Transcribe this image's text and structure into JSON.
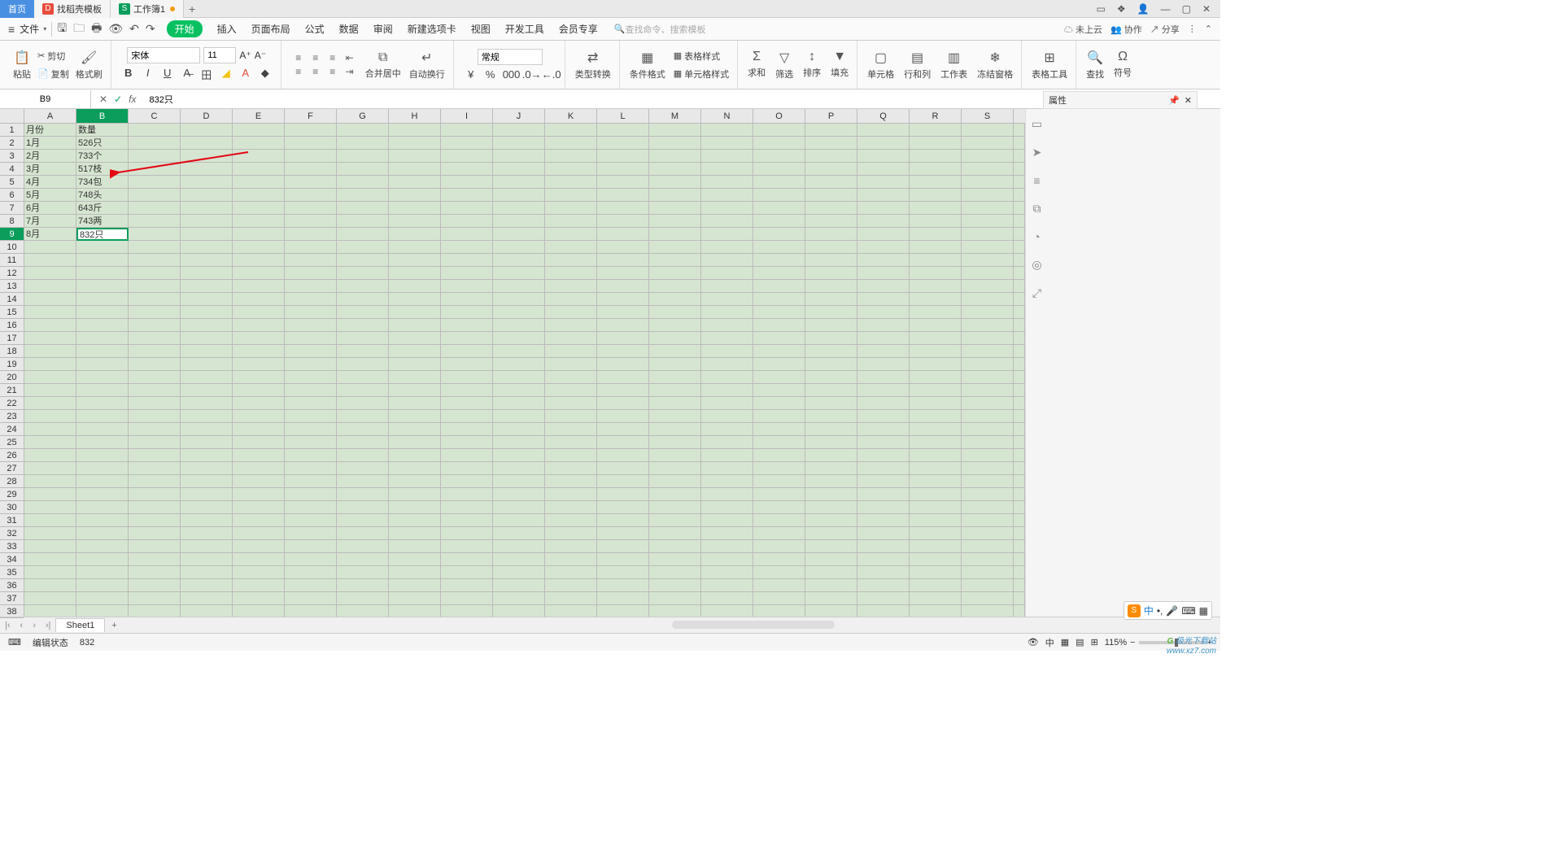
{
  "tabs": {
    "home": "首页",
    "template": "找稻壳模板",
    "workbook": "工作簿1"
  },
  "menu": {
    "file": "文件",
    "items": [
      "开始",
      "插入",
      "页面布局",
      "公式",
      "数据",
      "审阅",
      "新建选项卡",
      "视图",
      "开发工具",
      "会员专享"
    ],
    "search_placeholder": "查找命令、搜索模板",
    "cloud": "未上云",
    "collab": "协作",
    "share": "分享"
  },
  "ribbon": {
    "paste": "粘贴",
    "cut": "剪切",
    "copy": "复制",
    "format_painter": "格式刷",
    "font_name": "宋体",
    "font_size": "11",
    "merge": "合并居中",
    "wrap": "自动换行",
    "number_format": "常规",
    "type_convert": "类型转换",
    "cond_fmt": "条件格式",
    "table_style": "表格样式",
    "cell_style": "单元格样式",
    "sum": "求和",
    "filter": "筛选",
    "sort": "排序",
    "fill": "填充",
    "cell": "单元格",
    "rowcol": "行和列",
    "worksheet": "工作表",
    "freeze": "冻结窗格",
    "table_tools": "表格工具",
    "find": "查找",
    "symbol": "符号"
  },
  "cell_ref": {
    "name": "B9",
    "formula": "832只"
  },
  "side": {
    "title": "属性"
  },
  "columns": [
    "A",
    "B",
    "C",
    "D",
    "E",
    "F",
    "G",
    "H",
    "I",
    "J",
    "K",
    "L",
    "M",
    "N",
    "O",
    "P",
    "Q",
    "R",
    "S"
  ],
  "rows": 38,
  "selected_row": 9,
  "selected_col": "B",
  "active_cell_text": "832只",
  "cells": {
    "A1": "月份",
    "B1": "数量",
    "A2": "1月",
    "B2": "526只",
    "A3": "2月",
    "B3": "733个",
    "A4": "3月",
    "B4": "517枝",
    "A5": "4月",
    "B5": "734包",
    "A6": "5月",
    "B6": "748头",
    "A7": "6月",
    "B7": "643斤",
    "A8": "7月",
    "B8": "743两",
    "A9": "8月",
    "B9": "832只"
  },
  "sheet_tabs": {
    "sheet1": "Sheet1"
  },
  "status": {
    "mode": "编辑状态",
    "value": "832",
    "zoom": "115%"
  },
  "ime": {
    "lang": "中"
  },
  "watermark": {
    "line1": "极光下载站",
    "line2": "www.xz7.com"
  }
}
